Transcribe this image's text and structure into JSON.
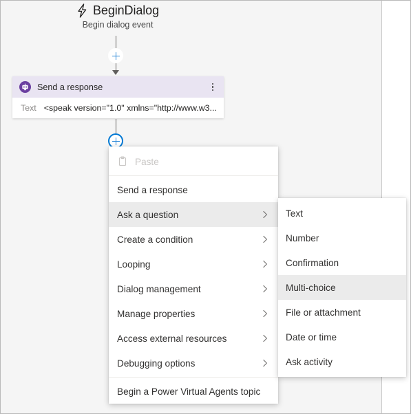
{
  "trigger": {
    "icon": "lightning-bolt-icon",
    "title": "BeginDialog",
    "subtitle": "Begin dialog event"
  },
  "connectors": {
    "add_node_top": {
      "icon": "plus-icon",
      "state": "idle"
    },
    "add_node_bottom": {
      "icon": "plus-icon",
      "state": "active"
    }
  },
  "card": {
    "icon": "bot-response-icon",
    "title": "Send a response",
    "overflow": "more-options-icon",
    "field_label": "Text",
    "field_value": "<speak version=\"1.0\" xmlns=\"http://www.w3....",
    "header_color": "#e9e4f2",
    "icon_color": "#6b3fa0"
  },
  "menu": {
    "items": [
      {
        "label": "Paste",
        "icon": "clipboard-icon",
        "disabled": true,
        "has_submenu": false,
        "selected": false,
        "divider_after": true
      },
      {
        "label": "Send a response",
        "disabled": false,
        "has_submenu": false,
        "selected": false,
        "divider_after": false
      },
      {
        "label": "Ask a question",
        "disabled": false,
        "has_submenu": true,
        "selected": true,
        "divider_after": false
      },
      {
        "label": "Create a condition",
        "disabled": false,
        "has_submenu": true,
        "selected": false,
        "divider_after": false
      },
      {
        "label": "Looping",
        "disabled": false,
        "has_submenu": true,
        "selected": false,
        "divider_after": false
      },
      {
        "label": "Dialog management",
        "disabled": false,
        "has_submenu": true,
        "selected": false,
        "divider_after": false
      },
      {
        "label": "Manage properties",
        "disabled": false,
        "has_submenu": true,
        "selected": false,
        "divider_after": false
      },
      {
        "label": "Access external resources",
        "disabled": false,
        "has_submenu": true,
        "selected": false,
        "divider_after": false
      },
      {
        "label": "Debugging options",
        "disabled": false,
        "has_submenu": true,
        "selected": false,
        "divider_after": true
      },
      {
        "label": "Begin a Power Virtual Agents topic",
        "disabled": false,
        "has_submenu": false,
        "selected": false,
        "divider_after": false
      }
    ]
  },
  "submenu": {
    "parent": "Ask a question",
    "items": [
      {
        "label": "Text",
        "selected": false
      },
      {
        "label": "Number",
        "selected": false
      },
      {
        "label": "Confirmation",
        "selected": false
      },
      {
        "label": "Multi-choice",
        "selected": true
      },
      {
        "label": "File or attachment",
        "selected": false
      },
      {
        "label": "Date or time",
        "selected": false
      },
      {
        "label": "Ask activity",
        "selected": false
      }
    ]
  },
  "colors": {
    "canvas": "#f5f5f5",
    "accent_blue": "#0078d4",
    "highlight": "#ebebeb"
  }
}
